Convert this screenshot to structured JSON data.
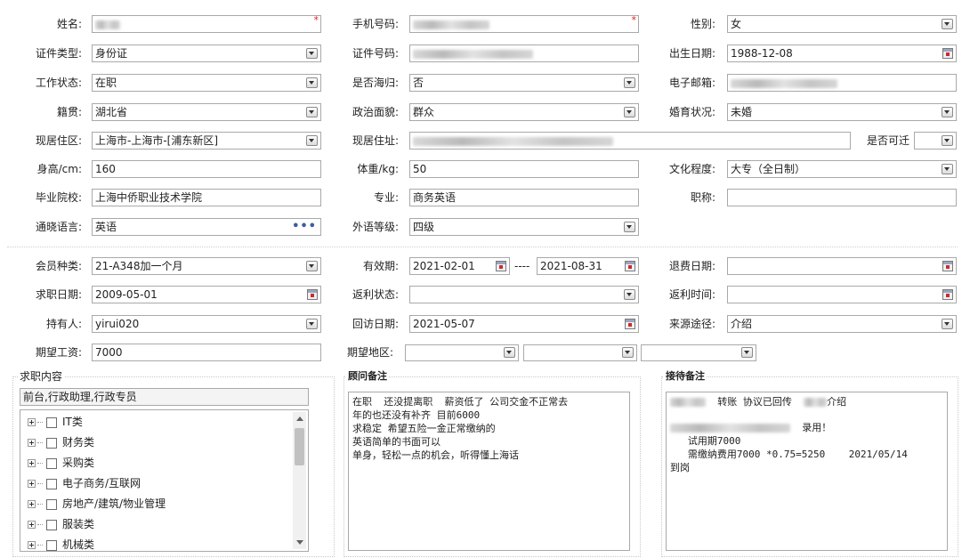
{
  "labels": {
    "name": "姓名:",
    "phone": "手机号码:",
    "gender": "性别:",
    "id_type": "证件类型:",
    "id_number": "证件号码:",
    "birthdate": "出生日期:",
    "work_status": "工作状态:",
    "returnee": "是否海归:",
    "email": "电子邮箱:",
    "native_place": "籍贯:",
    "political": "政治面貌:",
    "marital": "婚育状况:",
    "residence_area": "现居住区:",
    "residence_addr": "现居住址:",
    "relocate": "是否可迁",
    "height": "身高/cm:",
    "weight": "体重/kg:",
    "education": "文化程度:",
    "school": "毕业院校:",
    "major": "专业:",
    "title": "职称:",
    "language": "通晓语言:",
    "lang_level": "外语等级:",
    "member_type": "会员种类:",
    "validity": "有效期:",
    "refund_date": "退费日期:",
    "job_date": "求职日期:",
    "rebate_status": "返利状态:",
    "rebate_time": "返利时间:",
    "holder": "持有人:",
    "revisit_date": "回访日期:",
    "source": "来源途径:",
    "expected_salary": "期望工资:",
    "expected_area": "期望地区:"
  },
  "values": {
    "gender": "女",
    "id_type": "身份证",
    "birthdate": "1988-12-08",
    "work_status": "在职",
    "returnee": "否",
    "native_place": "湖北省",
    "political": "群众",
    "marital": "未婚",
    "residence_area": "上海市-上海市-[浦东新区]",
    "relocate": "",
    "height": "160",
    "weight": "50",
    "education": "大专（全日制）",
    "school": "上海中侨职业技术学院",
    "major": "商务英语",
    "title": "",
    "language": "英语",
    "lang_level": "四级",
    "member_type": "21-A348加一个月",
    "validity_from": "2021-02-01",
    "validity_sep": "----",
    "validity_to": "2021-08-31",
    "refund_date": "",
    "job_date": "2009-05-01",
    "rebate_status": "",
    "rebate_time": "",
    "holder": "yirui020",
    "revisit_date": "2021-05-07",
    "source": "介绍",
    "expected_salary": "7000",
    "expected_area_1": "",
    "expected_area_2": "",
    "expected_area_3": ""
  },
  "required_mark": "*",
  "panels": {
    "job_content": {
      "title": "求职内容",
      "summary": "前台,行政助理,行政专员",
      "items": [
        "IT类",
        "财务类",
        "采购类",
        "电子商务/互联网",
        "房地产/建筑/物业管理",
        "服装类",
        "机械类"
      ]
    },
    "consultant_note": {
      "title": "顾问备注",
      "text": "在职  还没提离职  薪资低了 公司交金不正常去\n年的也还没有补齐 目前6000\n求稳定 希望五险一金正常缴纳的\n英语简单的书面可以\n单身，轻松一点的机会，听得懂上海话"
    },
    "reception_note": {
      "title": "接待备注",
      "line1_text": "转账 协议已回传",
      "line1_suffix": "介绍",
      "line2_suffix": "录用！",
      "line3": "   试用期7000",
      "line4": "   需缴纳费用7000 *0.75=5250    2021/05/14",
      "line5": "到岗"
    }
  },
  "colors": {
    "required": "#e02020",
    "border": "#a9a9a9",
    "accent_dots": "#3a5f9f"
  }
}
